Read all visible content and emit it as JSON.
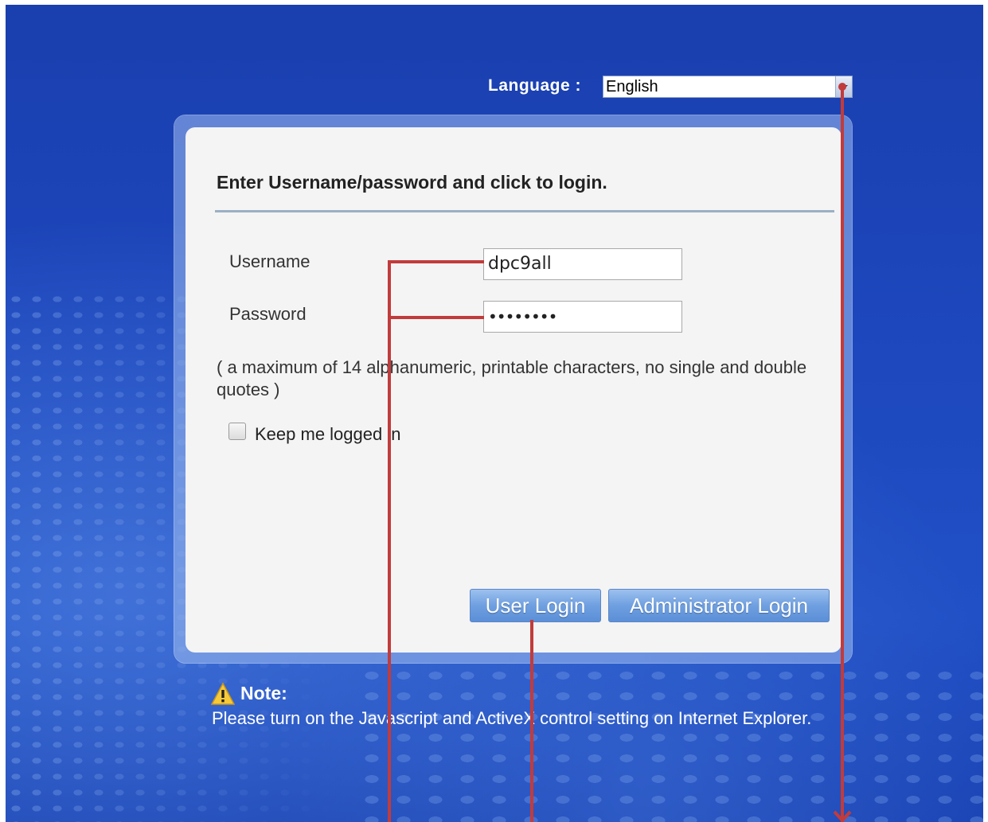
{
  "language": {
    "label": "Language :",
    "selected": "English"
  },
  "login": {
    "heading": "Enter Username/password and click to login.",
    "username_label": "Username",
    "username_value": "dpc9all",
    "password_label": "Password",
    "password_value": "••••••••",
    "hint": "( a maximum of 14 alphanumeric, printable characters, no single and double quotes )",
    "keep_logged_in_label": "Keep me logged in",
    "keep_logged_in_checked": false,
    "user_login_label": "User Login",
    "admin_login_label": "Administrator Login"
  },
  "note": {
    "title": "Note:",
    "text": "Please turn on the Javascript and ActiveX control setting on Internet Explorer."
  },
  "colors": {
    "background": "#1d47bd",
    "annotation": "#c23b3b",
    "button": "#6f9fe0"
  },
  "icons": {
    "note": "warning-icon",
    "dropdown": "chevron-down-icon"
  }
}
